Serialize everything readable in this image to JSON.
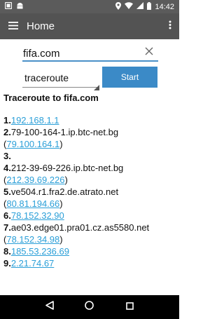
{
  "status_bar": {
    "time": "14:42",
    "left_icons": [
      "notification-box-icon",
      "android-icon"
    ],
    "right_icons": [
      "location-pin-icon",
      "wifi-icon",
      "cell-signal-icon",
      "battery-icon"
    ]
  },
  "app_bar": {
    "title": "Home",
    "menu_icon": "hamburger-menu-icon",
    "overflow_icon": "more-vertical-icon"
  },
  "form": {
    "host_value": "fifa.com",
    "mode_value": "traceroute",
    "start_label": "Start"
  },
  "results": {
    "heading": "Traceroute to fifa.com",
    "lines": [
      [
        {
          "t": "1.",
          "k": "num"
        },
        {
          "t": "192.168.1.1",
          "k": "link"
        }
      ],
      [
        {
          "t": "2.",
          "k": "num"
        },
        {
          "t": "79-100-164-1.ip.btc-net.bg",
          "k": "text"
        }
      ],
      [
        {
          "t": "(",
          "k": "text"
        },
        {
          "t": "79.100.164.1",
          "k": "link"
        },
        {
          "t": ")",
          "k": "text"
        }
      ],
      [
        {
          "t": "3.",
          "k": "num"
        }
      ],
      [
        {
          "t": "4.",
          "k": "num"
        },
        {
          "t": "212-39-69-226.ip.btc-net.bg",
          "k": "text"
        }
      ],
      [
        {
          "t": "(",
          "k": "text"
        },
        {
          "t": "212.39.69.226",
          "k": "link"
        },
        {
          "t": ")",
          "k": "text"
        }
      ],
      [
        {
          "t": "5.",
          "k": "num"
        },
        {
          "t": "ve504.r1.fra2.de.atrato.net",
          "k": "text"
        }
      ],
      [
        {
          "t": "(",
          "k": "text"
        },
        {
          "t": "80.81.194.66",
          "k": "link"
        },
        {
          "t": ")",
          "k": "text"
        }
      ],
      [
        {
          "t": "6.",
          "k": "num"
        },
        {
          "t": "78.152.32.90",
          "k": "link"
        }
      ],
      [
        {
          "t": "7.",
          "k": "num"
        },
        {
          "t": "ae03.edge01.pra01.cz.as5580.net",
          "k": "text"
        }
      ],
      [
        {
          "t": "(",
          "k": "text"
        },
        {
          "t": "78.152.34.98",
          "k": "link"
        },
        {
          "t": ")",
          "k": "text"
        }
      ],
      [
        {
          "t": "8.",
          "k": "num"
        },
        {
          "t": "185.53.236.69",
          "k": "link"
        }
      ],
      [
        {
          "t": "9.",
          "k": "num"
        },
        {
          "t": "2.21.74.67",
          "k": "link"
        }
      ]
    ]
  },
  "nav_bar": {
    "back_icon": "back-triangle-icon",
    "home_icon": "home-circle-icon",
    "recents_icon": "recents-square-icon"
  },
  "colors": {
    "status_bar": "#5b5b5b",
    "app_bar": "#535353",
    "accent": "#3b8ac7",
    "link": "#2b9fd8",
    "nav_bar": "#000000"
  }
}
